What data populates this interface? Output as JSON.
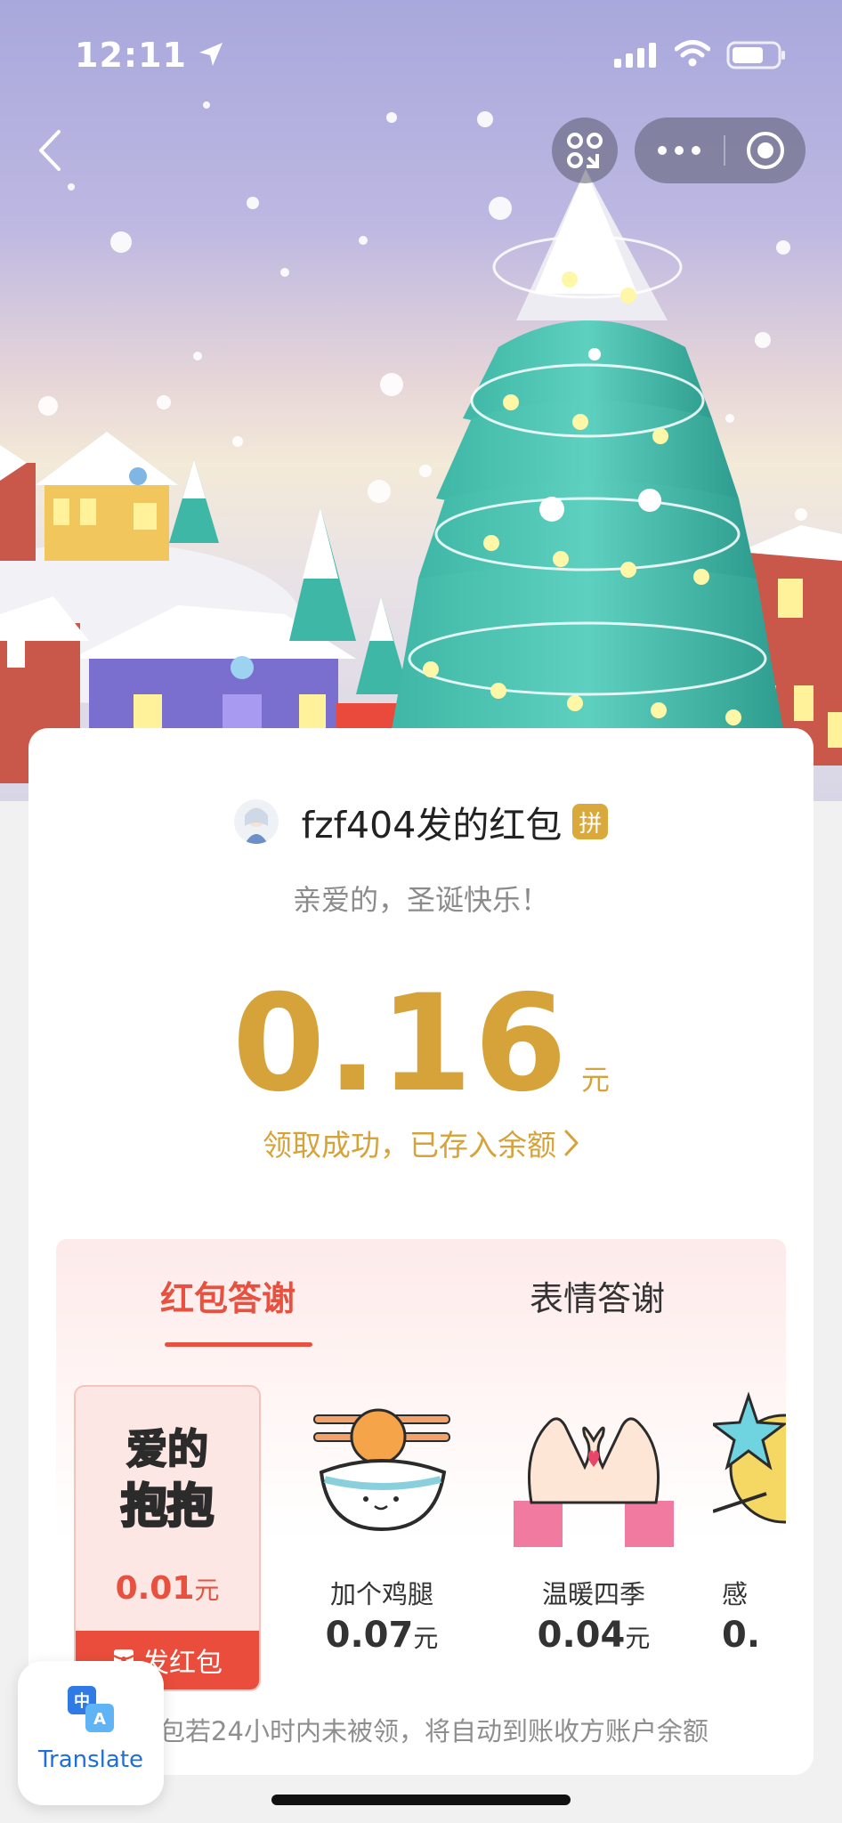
{
  "status_bar": {
    "time": "12:11"
  },
  "red_packet": {
    "sender_title": "fzf404发的红包",
    "pin_badge": "拼",
    "greeting": "亲爱的，圣诞快乐！",
    "amount": "0.16",
    "unit": "元",
    "stored_link": "领取成功，已存入余额"
  },
  "thanks": {
    "tabs": [
      {
        "label": "红包答谢",
        "active": true
      },
      {
        "label": "表情答谢",
        "active": false
      }
    ],
    "gifts": [
      {
        "name": "爱的抱抱",
        "price": "0.01",
        "unit": "元",
        "send_label": "发红包",
        "selected": true
      },
      {
        "name": "加个鸡腿",
        "price": "0.07",
        "unit": "元"
      },
      {
        "name": "温暖四季",
        "price": "0.04",
        "unit": "元"
      },
      {
        "name": "感",
        "price": "0.",
        "unit": ""
      }
    ]
  },
  "notice": "红包若24小时内未被领，将自动到账收方账户余额",
  "translate": {
    "label": "Translate"
  },
  "colors": {
    "accent_red": "#e8513f",
    "gold": "#d6a33a"
  }
}
